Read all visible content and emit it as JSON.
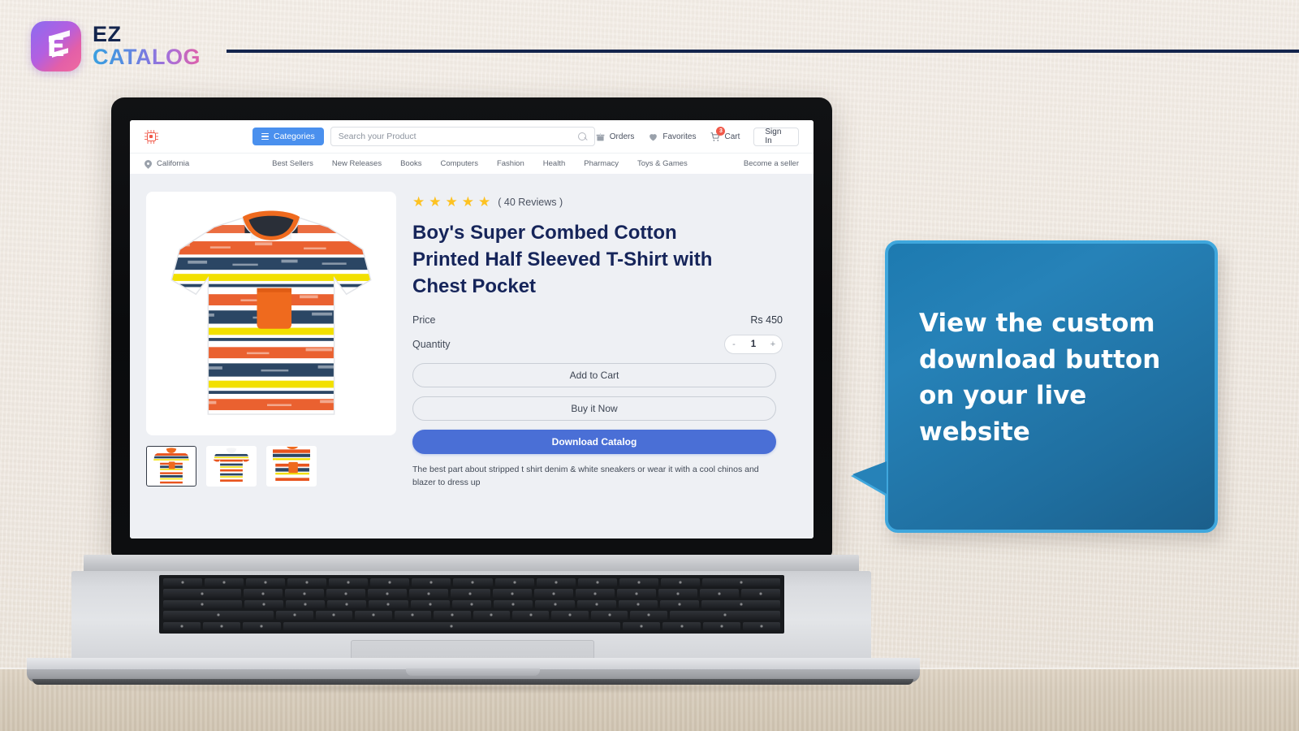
{
  "brand": {
    "ez": "EZ",
    "catalog": "CATALOG",
    "mark_glyph": "E",
    "accent_purple": "#8b6cf0",
    "accent_pink": "#e35fa8",
    "navy": "#14254d"
  },
  "site": {
    "logo_icon": "chip-logo-icon",
    "categories_button": "Categories",
    "search": {
      "placeholder": "Search your Product",
      "value": ""
    },
    "actions": [
      {
        "label": "Orders",
        "icon": "orders-box-icon",
        "badge": ""
      },
      {
        "label": "Favorites",
        "icon": "heart-icon",
        "badge": ""
      },
      {
        "label": "Cart",
        "icon": "cart-icon",
        "badge": "3"
      }
    ],
    "sign_in": "Sign In",
    "location": "California",
    "subnav": [
      "Best Sellers",
      "New Releases",
      "Books",
      "Computers",
      "Fashion",
      "Health",
      "Pharmacy",
      "Toys & Games"
    ],
    "become_seller": "Become a seller"
  },
  "product": {
    "reviews": "( 40 Reviews )",
    "stars_filled": 5,
    "star_color": "#fdc221",
    "title": "Boy's Super Combed Cotton Printed Half Sleeved T-Shirt with Chest Pocket",
    "price_label": "Price",
    "price_value": "Rs 450",
    "quantity_label": "Quantity",
    "quantity_value": "1",
    "qty_minus": "-",
    "qty_plus": "+",
    "add_to_cart": "Add to Cart",
    "buy_now": "Buy it Now",
    "download_catalog": "Download Catalog",
    "download_button_color": "#4a6fd6",
    "description": "The best part about stripped t shirt denim & white sneakers or wear it with a cool chinos and blazer to dress up",
    "thumbnails": [
      {
        "name": "thumbnail-front-pocket",
        "selected": true
      },
      {
        "name": "thumbnail-back",
        "selected": false
      },
      {
        "name": "thumbnail-detail",
        "selected": false
      }
    ]
  },
  "callout": {
    "text": "View the custom download button on your live website",
    "fill": "#2682b8",
    "border": "#3fa7dd",
    "text_color": "#ffffff"
  }
}
